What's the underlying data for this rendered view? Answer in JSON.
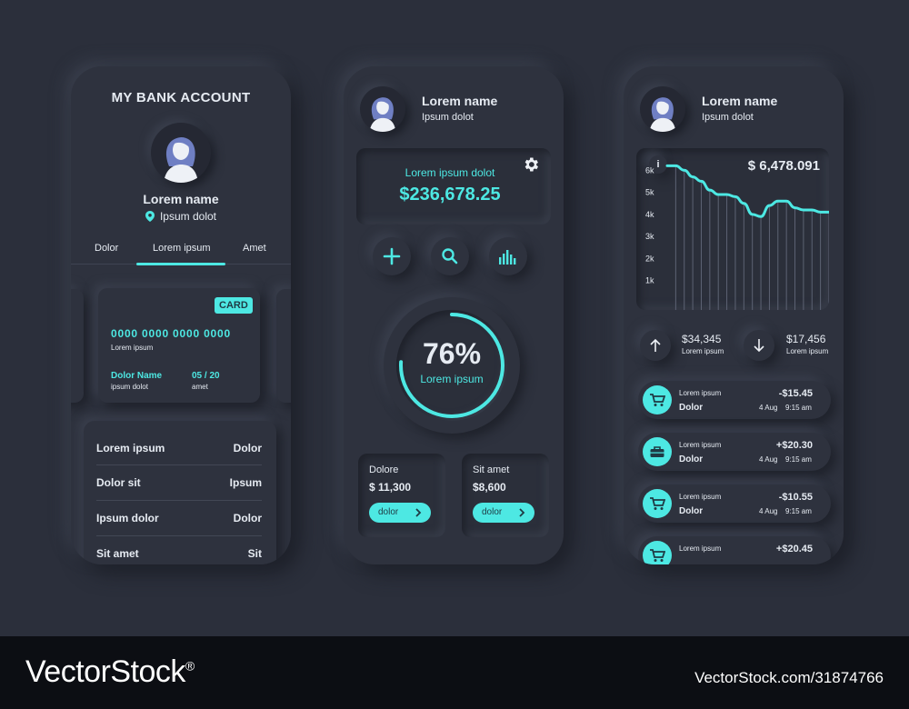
{
  "colors": {
    "accent": "#4de8e3",
    "background": "#2e323e",
    "footer": "#0c0e13"
  },
  "screen1": {
    "title": "MY BANK ACCOUNT",
    "profile": {
      "name": "Lorem name",
      "location": "Ipsum dolot",
      "location_icon": "map-pin-icon"
    },
    "tabs": [
      "Dolor",
      "Lorem ipsum",
      "Amet"
    ],
    "active_tab": "Lorem ipsum",
    "card": {
      "badge": "CARD",
      "number": "0000 0000 0000 0000",
      "number_label": "Lorem ipsum",
      "holder": "Dolor Name",
      "holder_label": "ipsum dolot",
      "expiry": "05 / 20",
      "expiry_label": "amet"
    },
    "list": [
      {
        "label": "Lorem ipsum",
        "value": "Dolor"
      },
      {
        "label": "Dolor sit",
        "value": "Ipsum"
      },
      {
        "label": "Ipsum dolor",
        "value": "Dolor"
      },
      {
        "label": "Sit amet",
        "value": "Sit"
      }
    ]
  },
  "screen2": {
    "profile": {
      "name": "Lorem name",
      "sub": "Ipsum dolot"
    },
    "balance": {
      "label": "Lorem ipsum dolot",
      "value": "$236,678.25",
      "icon": "gear-icon"
    },
    "actions": [
      {
        "icon": "plus-icon"
      },
      {
        "icon": "search-icon"
      },
      {
        "icon": "bar-chart-icon"
      }
    ],
    "progress": {
      "value": "76%",
      "fraction": 0.76,
      "label": "Lorem ipsum"
    },
    "cards": [
      {
        "title": "Dolore",
        "amount": "$ 11,300",
        "button": "dolor"
      },
      {
        "title": "Sit amet",
        "amount": "$8,600",
        "button": "dolor"
      }
    ]
  },
  "screen3": {
    "profile": {
      "name": "Lorem name",
      "sub": "Ipsum dolot"
    },
    "chart_header": {
      "info": "i",
      "total": "$ 6,478.091"
    },
    "chart_data": {
      "type": "line",
      "title": "",
      "xlabel": "",
      "ylabel": "",
      "y_ticks": [
        "6k",
        "5k",
        "4k",
        "3k",
        "2k",
        "1k"
      ],
      "ylim": [
        0,
        7
      ],
      "series": [
        {
          "values": [
            6.2,
            6.2,
            6.0,
            5.7,
            5.5,
            5.1,
            4.9,
            4.9,
            4.8,
            4.5,
            4.0,
            3.9,
            4.4,
            4.6,
            4.6,
            4.3,
            4.2,
            4.2,
            4.1,
            4.1
          ]
        }
      ]
    },
    "stats": [
      {
        "icon": "arrow-up-icon",
        "amount": "$34,345",
        "label": "Lorem ipsum"
      },
      {
        "icon": "arrow-down-icon",
        "amount": "$17,456",
        "label": "Lorem ipsum"
      }
    ],
    "transactions": [
      {
        "icon": "cart-icon",
        "title": "Lorem ipsum",
        "sub": "Dolor",
        "amount": "-$15.45",
        "date": "4 Aug",
        "time": "9:15 am"
      },
      {
        "icon": "toolbox-icon",
        "title": "Lorem ipsum",
        "sub": "Dolor",
        "amount": "+$20.30",
        "date": "4 Aug",
        "time": "9:15 am"
      },
      {
        "icon": "cart-icon",
        "title": "Lorem ipsum",
        "sub": "Dolor",
        "amount": "-$10.55",
        "date": "4 Aug",
        "time": "9:15 am"
      },
      {
        "icon": "cart-icon",
        "title": "Lorem ipsum",
        "sub": "",
        "amount": "+$20.45",
        "date": "",
        "time": ""
      }
    ]
  },
  "footer": {
    "brand": "VectorStock",
    "registered": "®",
    "url": "VectorStock.com/31874766"
  }
}
